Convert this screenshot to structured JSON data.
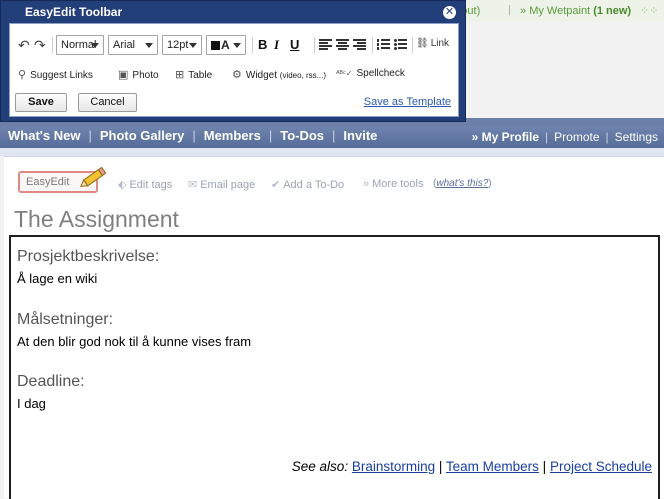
{
  "background": {
    "sign_out": "gn out)",
    "sep": "|",
    "my_wetpaint_label": "My Wetpaint",
    "my_wetpaint_count": "(1 new)",
    "nav": [
      "What's New",
      "Photo Gallery",
      "Members",
      "To-Dos",
      "Invite"
    ],
    "nav_right": [
      "» My Profile",
      "Promote",
      "Settings"
    ]
  },
  "dialog": {
    "title": "EasyEdit Toolbar",
    "close_symbol": "✕",
    "format_select": "Normal",
    "font_select": "Arial",
    "size_select": "12pt",
    "color_select": "A",
    "bold": "B",
    "italic": "I",
    "underline": "U",
    "link_label": "Link",
    "suggest_links": "Suggest Links",
    "photo": "Photo",
    "table": "Table",
    "widget": "Widget",
    "widget_hint": "(video, rss...)",
    "spellcheck": "Spellcheck",
    "save": "Save",
    "cancel": "Cancel",
    "save_as_template": "Save as Template"
  },
  "actions": {
    "easyedit": "EasyEdit",
    "edit_tags": "Edit tags",
    "email_page": "Email page",
    "add_todo": "Add a To-Do",
    "more_tools": "More tools",
    "whats_this": "what's this?"
  },
  "page": {
    "title": "The Assignment",
    "heading1": "Prosjektbeskrivelse:",
    "text1": "Å lage en wiki",
    "heading2": "Målsetninger:",
    "text2": "At den blir god nok til å kunne vises fram",
    "heading3": "Deadline:",
    "text3": "I dag",
    "see_also_label": "See also:",
    "links": [
      "Brainstorming",
      "Team Members",
      "Project Schedule"
    ]
  },
  "colors": {
    "nav_bar": "#6f84ad",
    "dialog_frame": "#233f7a",
    "link": "#1a3f9f",
    "wetpaint_green": "#5a9a3a",
    "easyedit_border": "#e08a84"
  }
}
